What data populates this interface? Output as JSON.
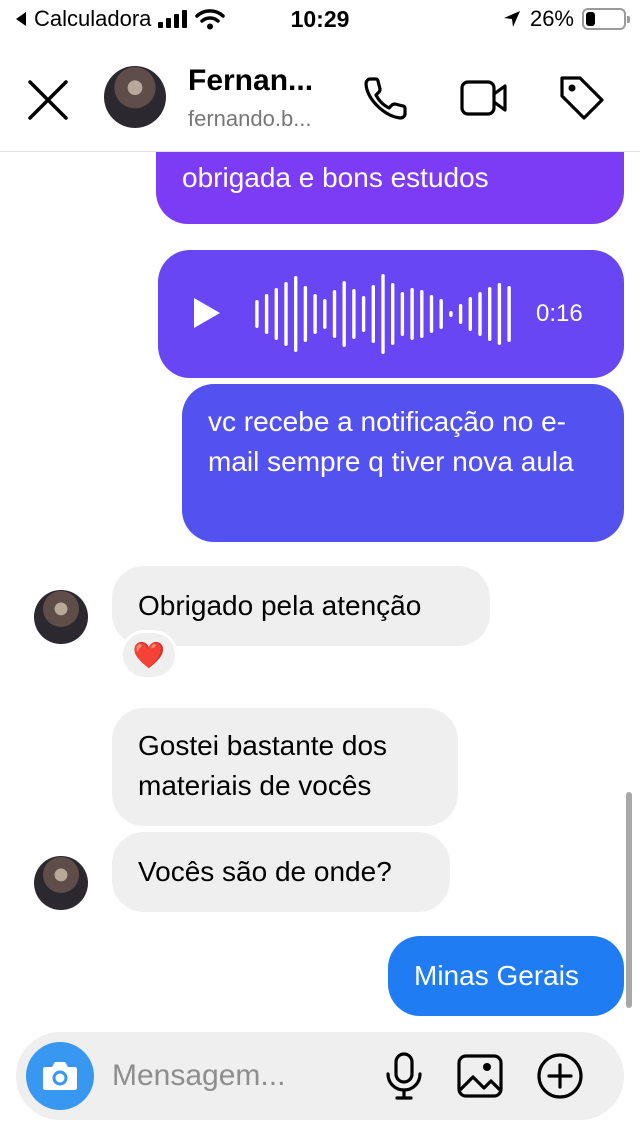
{
  "status_bar": {
    "back_app": "Calculadora",
    "time": "10:29",
    "battery": "26%",
    "battery_level": 0.26
  },
  "header": {
    "name": "Fernan...",
    "username": "fernando.b..."
  },
  "messages": [
    {
      "direction": "out",
      "text": "obrigada e bons estudos"
    },
    {
      "direction": "out",
      "type": "audio",
      "duration": "0:16"
    },
    {
      "direction": "out",
      "text": "vc recebe a notificação no e-mail sempre q tiver nova aula"
    },
    {
      "direction": "in",
      "text": "Obrigado pela atenção",
      "reaction": "❤️"
    },
    {
      "direction": "in",
      "text": "Gostei bastante dos materiais de vocês"
    },
    {
      "direction": "in",
      "text": "Vocês são de onde?"
    },
    {
      "direction": "out",
      "text": "Minas Gerais"
    }
  ],
  "composer": {
    "placeholder": "Mensagem..."
  },
  "colors": {
    "bubble_top": "#7c3cf5",
    "bubble_mid": "#5b51f1",
    "bubble_blue": "#1f7cf3",
    "incoming": "#efefef",
    "camera": "#3897f0"
  },
  "icons": {
    "close": "close-icon",
    "call": "phone-icon",
    "video": "video-camera-icon",
    "tag": "tag-icon",
    "camera": "camera-icon",
    "mic": "microphone-icon",
    "gallery": "image-icon",
    "plus": "plus-circle-icon"
  }
}
